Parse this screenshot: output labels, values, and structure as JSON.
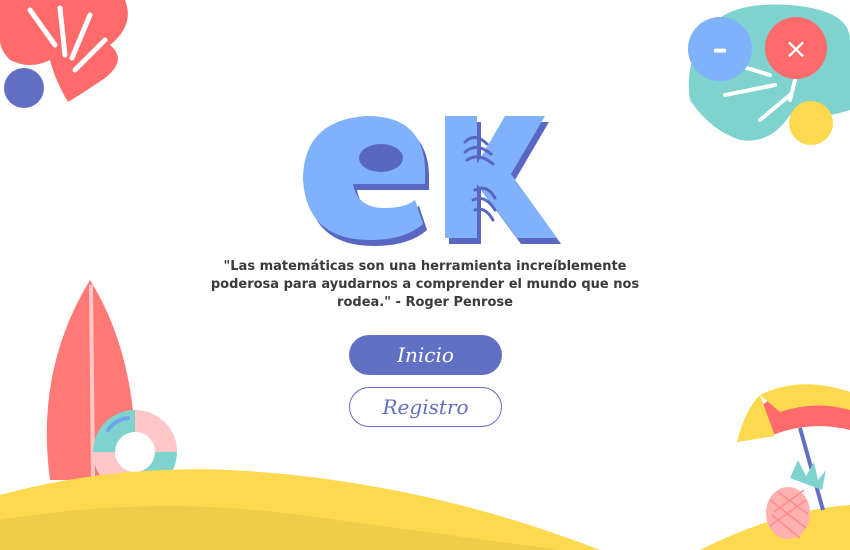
{
  "window_controls": {
    "minimize_label": "–",
    "close_label": "×"
  },
  "logo": {
    "text": "ek"
  },
  "quote": {
    "text": "\"Las matemáticas son una herramienta increíblemente poderosa para ayudarnos a comprender el mundo que nos rodea.\" - Roger Penrose"
  },
  "buttons": {
    "inicio": "Inicio",
    "registro": "Registro"
  },
  "colors": {
    "primary": "#6270c4",
    "light_blue": "#7fb2fb",
    "coral": "#ff6b6b",
    "sand": "#fcd94f",
    "teal": "#7fd3cf"
  },
  "decorations": [
    "monstera-leaf",
    "surfboard",
    "swim-ring",
    "sand-dunes",
    "beach-umbrella",
    "pineapple"
  ]
}
